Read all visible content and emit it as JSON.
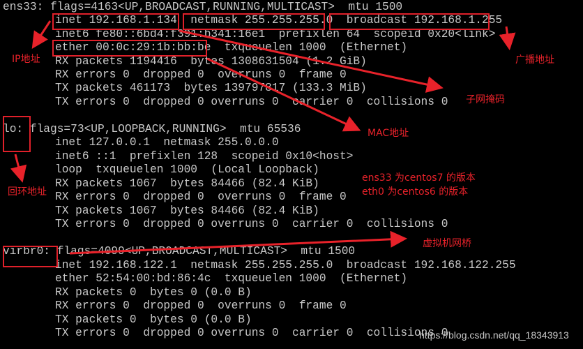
{
  "terminal": {
    "lines": [
      "ens33: flags=4163<UP,BROADCAST,RUNNING,MULTICAST>  mtu 1500",
      "inet 192.168.1.134  netmask 255.255.255.0  broadcast 192.168.1.255",
      "inet6 fe80::6bd4:f391:b341:16e1  prefixlen 64  scopeid 0x20<link>",
      "ether 00:0c:29:1b:bb:be  txqueuelen 1000  (Ethernet)",
      "RX packets 1194416  bytes 1308631504 (1.2 GiB)",
      "RX errors 0  dropped 0  overruns 0  frame 0",
      "TX packets 461173  bytes 139797817 (133.3 MiB)",
      "TX errors 0  dropped 0 overruns 0  carrier 0  collisions 0",
      "",
      "lo: flags=73<UP,LOOPBACK,RUNNING>  mtu 65536",
      "inet 127.0.0.1  netmask 255.0.0.0",
      "inet6 ::1  prefixlen 128  scopeid 0x10<host>",
      "loop  txqueuelen 1000  (Local Loopback)",
      "RX packets 1067  bytes 84466 (82.4 KiB)",
      "RX errors 0  dropped 0  overruns 0  frame 0",
      "TX packets 1067  bytes 84466 (82.4 KiB)",
      "TX errors 0  dropped 0 overruns 0  carrier 0  collisions 0",
      "",
      "virbr0: flags=4099<UP,BROADCAST,MULTICAST>  mtu 1500",
      "inet 192.168.122.1  netmask 255.255.255.0  broadcast 192.168.122.255",
      "ether 52:54:00:bd:86:4c  txqueuelen 1000  (Ethernet)",
      "RX packets 0  bytes 0 (0.0 B)",
      "RX errors 0  dropped 0  overruns 0  frame 0",
      "TX packets 0  bytes 0 (0.0 B)",
      "TX errors 0  dropped 0 overruns 0  carrier 0  collisions 0"
    ]
  },
  "annotations": {
    "ip_address": "IP地址",
    "broadcast_address": "广播地址",
    "subnet_mask": "子网掩码",
    "mac_address": "MAC地址",
    "loopback_address": "回环地址",
    "version_note_1": "ens33 为centos7 的版本",
    "version_note_2": "eth0  为centos6 的版本",
    "vm_bridge": "虚拟机网桥"
  },
  "watermark": "https://blog.csdn.net/qq_18343913",
  "colors": {
    "background": "#000000",
    "text": "#c8c8c8",
    "annotation": "#e8222a"
  }
}
